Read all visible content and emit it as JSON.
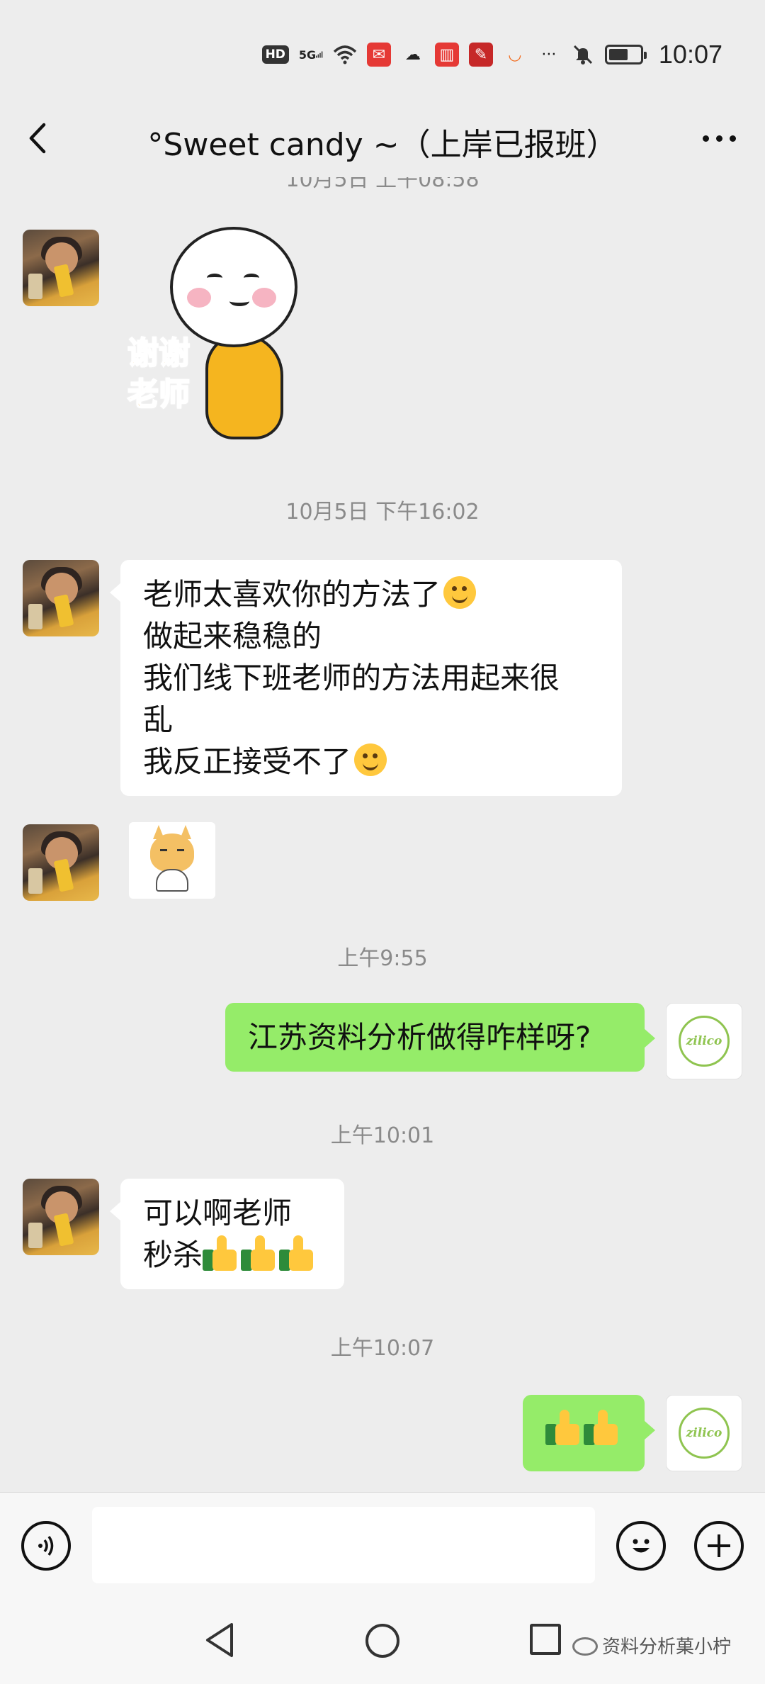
{
  "status_bar": {
    "hd": "HD",
    "network": "5G",
    "time": "10:07"
  },
  "header": {
    "title": "°Sweet candy ~（上岸已报班）"
  },
  "chat": {
    "timestamps": [
      "10月5日 上午08:58",
      "10月5日 下午16:02",
      "上午9:55",
      "上午10:01",
      "上午10:07"
    ],
    "sticker_text": [
      "谢谢",
      "老师"
    ],
    "msg1_lines": [
      "老师太喜欢你的方法了",
      "做起来稳稳的",
      "我们线下班老师的方法用起来很",
      "乱",
      "我反正接受不了"
    ],
    "msg2_text": "江苏资料分析做得咋样呀?",
    "msg3_lines": [
      "可以啊老师",
      "秒杀"
    ],
    "avatar_right_text": "zilico"
  },
  "watermark": "资料分析菓小柠",
  "colors": {
    "background": "#ededed",
    "sent_bubble": "#95ec69",
    "received_bubble": "#ffffff",
    "timestamp": "#8a8a8a"
  }
}
